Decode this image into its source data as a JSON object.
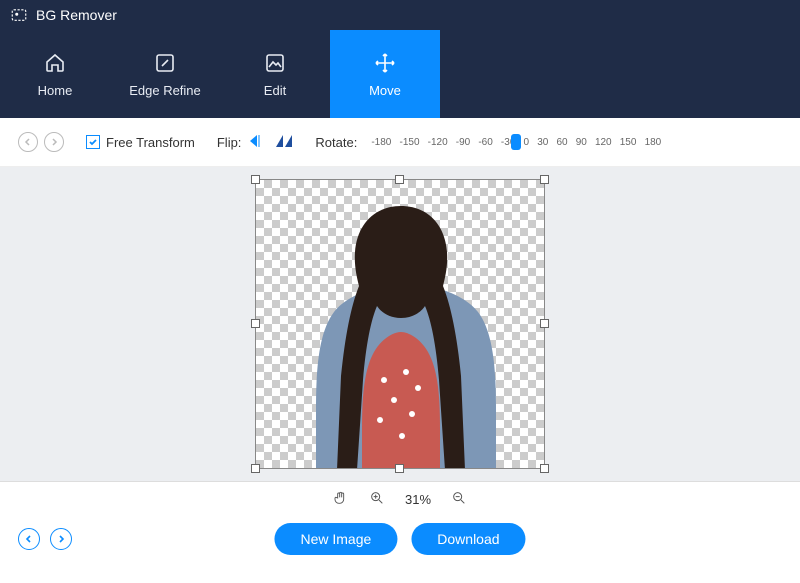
{
  "app": {
    "title": "BG Remover"
  },
  "tabs": {
    "home": "Home",
    "edge_refine": "Edge Refine",
    "edit": "Edit",
    "move": "Move",
    "active": "move"
  },
  "toolbar": {
    "free_transform_label": "Free Transform",
    "free_transform_checked": true,
    "flip_label": "Flip:",
    "rotate_label": "Rotate:",
    "rotate_ticks": [
      "-180",
      "-150",
      "-120",
      "-90",
      "-60",
      "-30",
      "0",
      "30",
      "60",
      "90",
      "120",
      "150",
      "180"
    ],
    "rotate_value": 0
  },
  "canvas": {
    "subject_desc": "Person with long dark hair wearing a blue denim jacket over a red floral top, background removed (transparent)"
  },
  "zoom": {
    "percent": "31%"
  },
  "footer": {
    "new_image": "New Image",
    "download": "Download"
  }
}
